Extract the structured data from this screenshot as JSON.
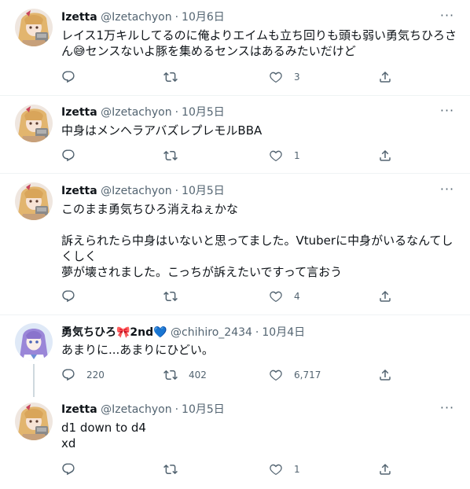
{
  "tweets": [
    {
      "name": "Izetta",
      "handle": "@Izetachyon",
      "sep": "·",
      "time": "10月6日",
      "text": "レイス1万キルしてるのに俺よりエイムも立ち回りも頭も弱い勇気ちひろさん😅センスないよ豚を集めるセンスはあるみたいだけど",
      "reply_count": "",
      "retweet_count": "",
      "like_count": "3"
    },
    {
      "name": "Izetta",
      "handle": "@Izetachyon",
      "sep": "·",
      "time": "10月5日",
      "text": "中身はメンヘラアバズレプレモルBBA",
      "reply_count": "",
      "retweet_count": "",
      "like_count": "1"
    },
    {
      "name": "Izetta",
      "handle": "@Izetachyon",
      "sep": "·",
      "time": "10月5日",
      "text": "このまま勇気ちひろ消えねぇかな\n\n訴えられたら中身はいないと思ってました。Vtuberに中身がいるなんてしくしく\n夢が壊されました。こっちが訴えたいですって言おう",
      "reply_count": "",
      "retweet_count": "",
      "like_count": "4"
    },
    {
      "name": "勇気ちひろ🎀2nd💙",
      "handle": "@chihiro_2434",
      "sep": "·",
      "time": "10月4日",
      "text": "あまりに...あまりにひどい。",
      "reply_count": "220",
      "retweet_count": "402",
      "like_count": "6,717"
    },
    {
      "name": "Izetta",
      "handle": "@Izetachyon",
      "sep": "·",
      "time": "10月5日",
      "text": "d1 down to d4\nxd",
      "reply_count": "",
      "retweet_count": "",
      "like_count": "1"
    }
  ],
  "more_label": "···",
  "colors": {
    "text": "#0f1419",
    "secondary": "#536471",
    "divider": "#eff3f4",
    "thread_line": "#cfd9de"
  },
  "icons": {
    "reply": "reply-icon",
    "retweet": "retweet-icon",
    "like": "heart-icon",
    "share": "share-icon",
    "more": "more-icon"
  }
}
